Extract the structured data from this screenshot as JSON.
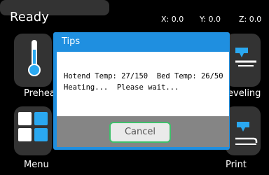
{
  "status": {
    "state": "Ready",
    "x": "X: 0.0",
    "y": "Y: 0.0",
    "z": "Z: 0.0"
  },
  "tiles": {
    "preheat": "Preheat",
    "leveling": "Leveling",
    "menu": "Menu",
    "print": "Print"
  },
  "dialog": {
    "title": "Tips",
    "line1": "Hotend Temp: 27/150  Bed Temp: 26/50",
    "line2": "Heating...  Please wait...",
    "cancel_label": "Cancel"
  },
  "colors": {
    "accent_blue": "#2aa8f0",
    "button_border_green": "#3fbf6b",
    "footer_gray": "#858585"
  },
  "icons": [
    "thermometer-icon",
    "bed-level-icon",
    "menu-grid-icon",
    "print-icon"
  ]
}
